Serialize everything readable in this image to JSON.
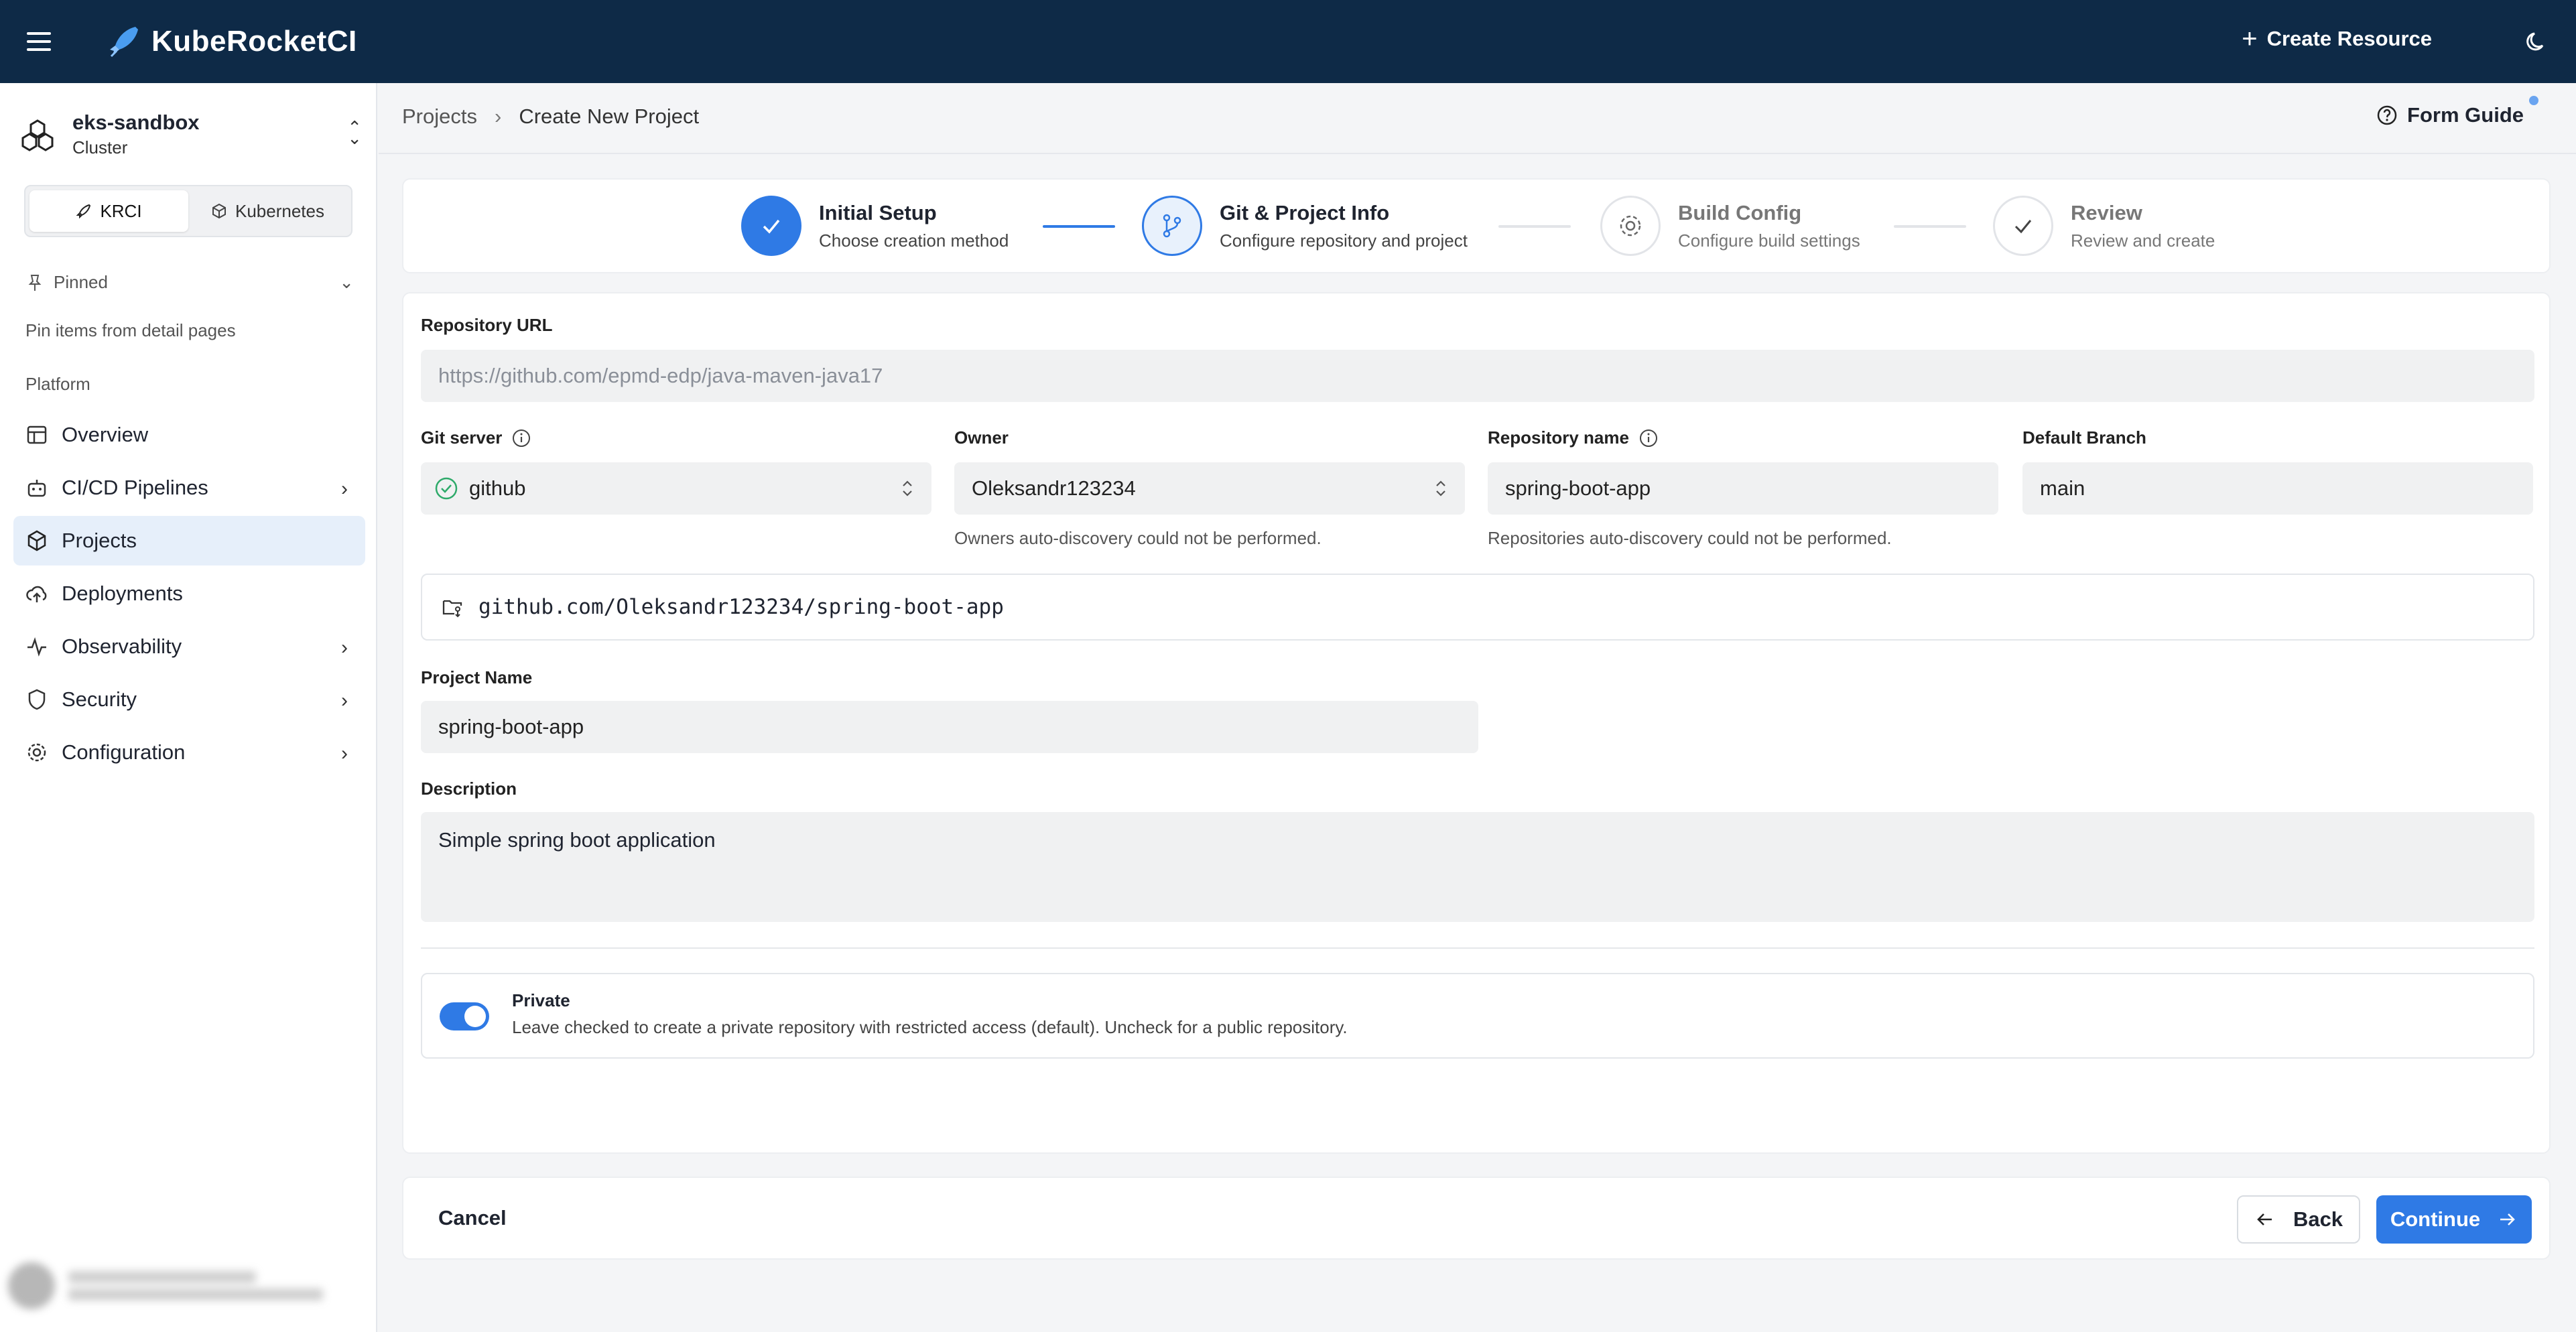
{
  "topbar": {
    "brand": "KubeRocketCI",
    "create_resource": "Create Resource"
  },
  "sidebar": {
    "cluster_name": "eks-sandbox",
    "cluster_type": "Cluster",
    "tabs": [
      {
        "label": "KRCI"
      },
      {
        "label": "Kubernetes"
      }
    ],
    "pinned_label": "Pinned",
    "pinned_hint": "Pin items from detail pages",
    "section_label": "Platform",
    "items": [
      {
        "label": "Overview"
      },
      {
        "label": "CI/CD Pipelines"
      },
      {
        "label": "Projects"
      },
      {
        "label": "Deployments"
      },
      {
        "label": "Observability"
      },
      {
        "label": "Security"
      },
      {
        "label": "Configuration"
      }
    ]
  },
  "breadcrumb": {
    "parent": "Projects",
    "current": "Create New Project"
  },
  "form_guide": "Form Guide",
  "steps": [
    {
      "title": "Initial Setup",
      "subtitle": "Choose creation method"
    },
    {
      "title": "Git & Project Info",
      "subtitle": "Configure repository and project"
    },
    {
      "title": "Build Config",
      "subtitle": "Configure build settings"
    },
    {
      "title": "Review",
      "subtitle": "Review and create"
    }
  ],
  "form": {
    "repo_url_label": "Repository URL",
    "repo_url_placeholder": "https://github.com/epmd-edp/java-maven-java17",
    "git_server_label": "Git server",
    "git_server_value": "github",
    "owner_label": "Owner",
    "owner_value": "Oleksandr123234",
    "owner_hint": "Owners auto-discovery could not be performed.",
    "repo_name_label": "Repository name",
    "repo_name_value": "spring-boot-app",
    "repo_name_hint": "Repositories auto-discovery could not be performed.",
    "default_branch_label": "Default Branch",
    "default_branch_value": "main",
    "repo_path": "github.com/Oleksandr123234/spring-boot-app",
    "project_name_label": "Project Name",
    "project_name_value": "spring-boot-app",
    "description_label": "Description",
    "description_value": "Simple spring boot application",
    "private_label": "Private",
    "private_desc": "Leave checked to create a private repository with restricted access (default). Uncheck for a public repository.",
    "private_checked": true
  },
  "footer": {
    "cancel": "Cancel",
    "back": "Back",
    "continue": "Continue"
  },
  "colors": {
    "navbar": "#0e2a47",
    "accent": "#2f7ae5",
    "active_nav": "#e6effa",
    "success": "#2eaa6a"
  }
}
